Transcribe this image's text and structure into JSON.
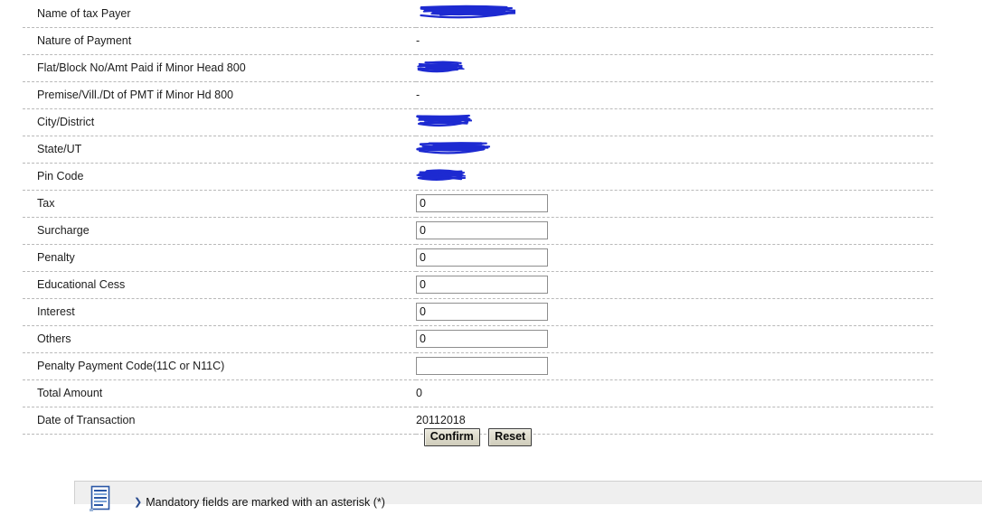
{
  "form": {
    "rows": [
      {
        "label": "Name of tax Payer",
        "type": "redacted",
        "redaction_width": 110
      },
      {
        "label": "Nature of Payment",
        "type": "text",
        "value": "-"
      },
      {
        "label": "Flat/Block No/Amt Paid if Minor Head 800",
        "type": "redacted",
        "redaction_width": 55
      },
      {
        "label": "Premise/Vill./Dt of PMT if Minor Hd 800",
        "type": "text",
        "value": "-"
      },
      {
        "label": "City/District",
        "type": "redacted",
        "redaction_width": 62
      },
      {
        "label": "State/UT",
        "type": "redacted",
        "redaction_width": 82
      },
      {
        "label": "Pin Code",
        "type": "redacted",
        "redaction_width": 55
      },
      {
        "label": "Tax",
        "type": "input",
        "value": "0"
      },
      {
        "label": "Surcharge",
        "type": "input",
        "value": "0"
      },
      {
        "label": "Penalty",
        "type": "input",
        "value": "0"
      },
      {
        "label": "Educational Cess",
        "type": "input",
        "value": "0"
      },
      {
        "label": "Interest",
        "type": "input",
        "value": "0"
      },
      {
        "label": "Others",
        "type": "input",
        "value": "0"
      },
      {
        "label": "Penalty Payment Code(11C or N11C)",
        "type": "input",
        "value": ""
      },
      {
        "label": "Total Amount",
        "type": "text",
        "value": "0"
      },
      {
        "label": "Date of Transaction",
        "type": "text",
        "value": "20112018"
      }
    ]
  },
  "buttons": {
    "confirm_label": "Confirm",
    "reset_label": "Reset"
  },
  "note": {
    "bullet": "❯",
    "text": "Mandatory fields are marked with an asterisk (*)",
    "icon": "document-lines-icon"
  },
  "colors": {
    "redaction": "#1d2ad1",
    "separator": "#b9b9b9",
    "panel_bg": "#efefef",
    "button_bg": "#d6d3c3"
  }
}
